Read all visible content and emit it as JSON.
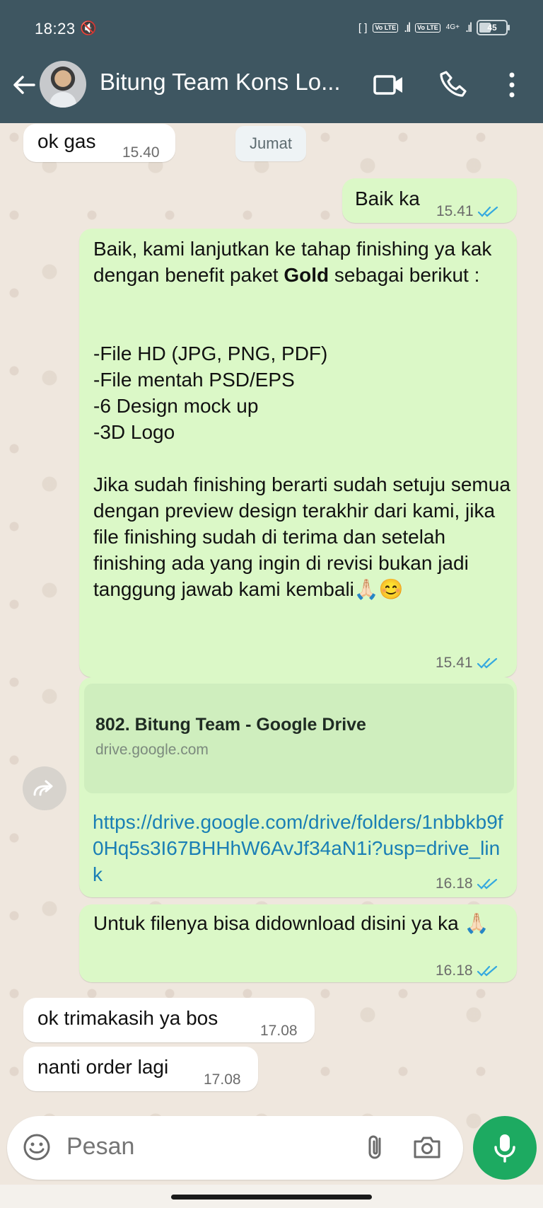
{
  "status_bar": {
    "time": "18:23",
    "mute_icon": "🔇",
    "sim1_label": "Vo LTE",
    "sim2_label": "Vo LTE",
    "network": "4G+",
    "battery": "45",
    "battery_level_percent": 45
  },
  "header": {
    "title": "Bitung Team Kons Lo...",
    "icons": [
      "back-arrow-icon",
      "video-call-icon",
      "voice-call-icon",
      "more-vertical-icon"
    ]
  },
  "messages": [
    {
      "type": "incoming",
      "text": "ok gas",
      "time": "15.40"
    },
    {
      "type": "day_separator",
      "text": "Jumat"
    },
    {
      "type": "outgoing",
      "text": "Baik ka",
      "time": "15.41"
    },
    {
      "type": "outgoing",
      "line1_pre": "Baik, kami lanjutkan ke tahap finishing ya kak dengan benefit paket ",
      "line1_bold": "Gold",
      "line1_post": " sebagai berikut :",
      "list": "-File HD (JPG, PNG, PDF)\n-File mentah PSD/EPS\n-6 Design mock up\n-3D Logo",
      "closing": "Jika sudah finishing berarti sudah setuju semua dengan preview design terakhir dari kami, jika file finishing sudah di terima dan setelah finishing ada yang ingin di revisi bukan jadi tanggung jawab kami kembali🙏🏻😊",
      "time": "15.41"
    },
    {
      "type": "outgoing_link",
      "preview_title": "802. Bitung Team - Google Drive",
      "preview_domain": "drive.google.com",
      "url": "https://drive.google.com/drive/folders/1nbbkb9f0Hq5s3I67BHHhW6AvJf34aN1i?usp=drive_link",
      "time": "16.18"
    },
    {
      "type": "outgoing",
      "text": "Untuk filenya bisa didownload disini ya ka 🙏🏻",
      "time": "16.18"
    },
    {
      "type": "incoming",
      "text": "ok trimakasih ya bos",
      "time": "17.08"
    },
    {
      "type": "incoming",
      "text": "nanti order lagi",
      "time": "17.08"
    }
  ],
  "composer": {
    "placeholder": "Pesan",
    "icons": [
      "emoji-icon",
      "attach-icon",
      "camera-icon",
      "mic-icon"
    ]
  },
  "colors": {
    "header": "#3e5661",
    "outgoing_bubble": "#dbf8c7",
    "incoming_bubble": "#ffffff",
    "link": "#1a7fb5",
    "read_ticks": "#34a8df",
    "mic_button": "#1daa61",
    "chat_background": "#efe7de"
  }
}
